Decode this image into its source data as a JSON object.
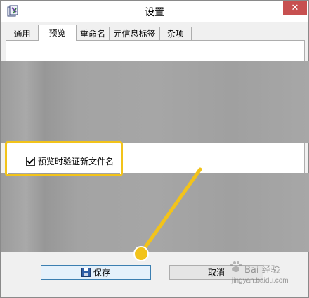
{
  "window": {
    "title": "设置",
    "close_glyph": "✕"
  },
  "tabs": [
    {
      "label": "通用",
      "active": false
    },
    {
      "label": "预览",
      "active": true
    },
    {
      "label": "重命名",
      "active": false
    },
    {
      "label": "元信息标签",
      "active": false
    },
    {
      "label": "杂项",
      "active": false
    }
  ],
  "preview": {
    "validate_checkbox": {
      "label": "预览时验证新文件名",
      "checked": true
    }
  },
  "buttons": {
    "save_label": "保存",
    "cancel_label": "取消"
  },
  "annotation": {
    "highlight_color": "#f2c31a"
  },
  "watermark": {
    "text": "Bai 经验",
    "subtext": "jingyan.baidu.com"
  }
}
